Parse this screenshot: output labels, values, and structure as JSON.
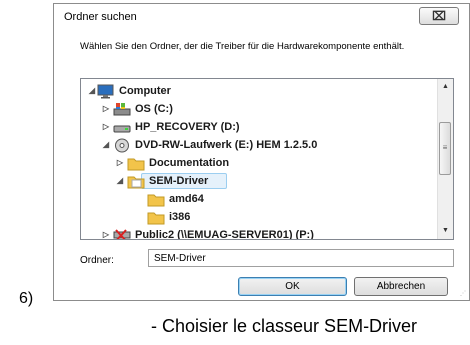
{
  "dialog": {
    "title": "Ordner suchen",
    "close_label": "⌧",
    "instruction": "Wählen Sie den Ordner, der die Treiber für die Hardwarekomponente enthält.",
    "tree": [
      {
        "label": "Computer",
        "icon": "computer-icon",
        "expander": "◢"
      },
      {
        "label": "OS (C:)",
        "icon": "os-drive-icon",
        "expander": "▷"
      },
      {
        "label": "HP_RECOVERY (D:)",
        "icon": "drive-icon",
        "expander": "▷"
      },
      {
        "label": "DVD-RW-Laufwerk (E:) HEM 1.2.5.0",
        "icon": "dvd-drive-icon",
        "expander": "◢"
      },
      {
        "label": "Documentation",
        "icon": "folder-icon",
        "expander": "▷"
      },
      {
        "label": "SEM-Driver",
        "icon": "folder-open-icon",
        "expander": "◢"
      },
      {
        "label": "amd64",
        "icon": "folder-icon",
        "expander": ""
      },
      {
        "label": "i386",
        "icon": "folder-icon",
        "expander": ""
      },
      {
        "label": "Public2 (\\\\EMUAG-SERVER01) (P:)",
        "icon": "network-drive-icon",
        "expander": "▷"
      }
    ],
    "folder_label": "Ordner:",
    "folder_value": "SEM-Driver",
    "ok_label": "OK",
    "cancel_label": "Abbrechen"
  },
  "step_number": "6)",
  "caption": "- Choisier le classeur SEM-Driver",
  "colors": {
    "selection": "#e5f1fb",
    "folder": "#f2c44a",
    "accent": "#3c7fb1"
  }
}
